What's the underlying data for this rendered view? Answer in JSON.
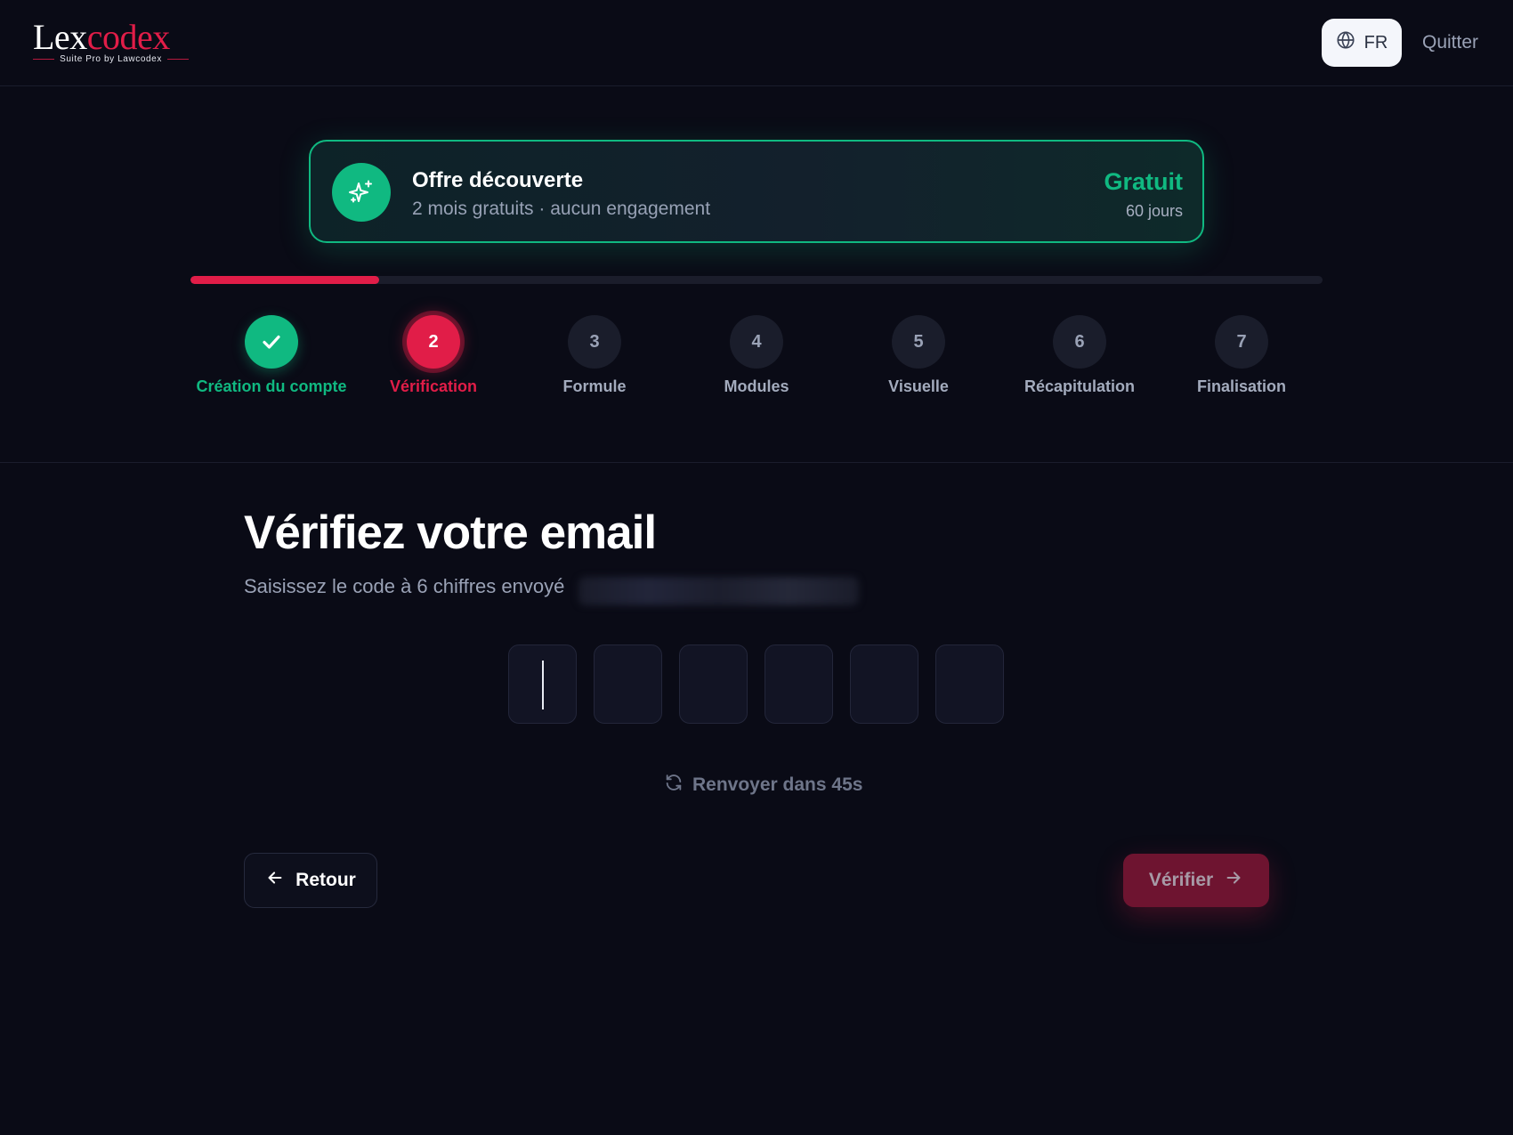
{
  "header": {
    "logo_part1": "Lex",
    "logo_part2": "codex",
    "logo_tagline": "Suite Pro by Lawcodex",
    "language": "FR",
    "quit_label": "Quitter",
    "icons": {
      "language": "globe-icon"
    }
  },
  "offer": {
    "title": "Offre découverte",
    "subtitle": "2 mois gratuits · aucun engagement",
    "price": "Gratuit",
    "duration": "60 jours",
    "icon": "sparkles-icon"
  },
  "progress": {
    "current_step": 2,
    "total_steps": 7,
    "fraction": 0.167
  },
  "steps": [
    {
      "number": "1",
      "label": "Création du compte",
      "status": "done"
    },
    {
      "number": "2",
      "label": "Vérification",
      "status": "active"
    },
    {
      "number": "3",
      "label": "Formule",
      "status": "pending"
    },
    {
      "number": "4",
      "label": "Modules",
      "status": "pending"
    },
    {
      "number": "5",
      "label": "Visuelle",
      "status": "pending"
    },
    {
      "number": "6",
      "label": "Récapitulation",
      "status": "pending"
    },
    {
      "number": "7",
      "label": "Finalisation",
      "status": "pending"
    }
  ],
  "main": {
    "title": "Vérifiez votre email",
    "subtitle": "Saisissez le code à 6 chiffres envoyé",
    "code_digits": [
      "",
      "",
      "",
      "",
      "",
      ""
    ],
    "resend_label": "Renvoyer dans 45s",
    "back_label": "Retour",
    "verify_label": "Vérifier"
  },
  "colors": {
    "background": "#0a0b16",
    "accent": "#e11d48",
    "success": "#10b981",
    "muted_text": "#9aa2b6"
  }
}
